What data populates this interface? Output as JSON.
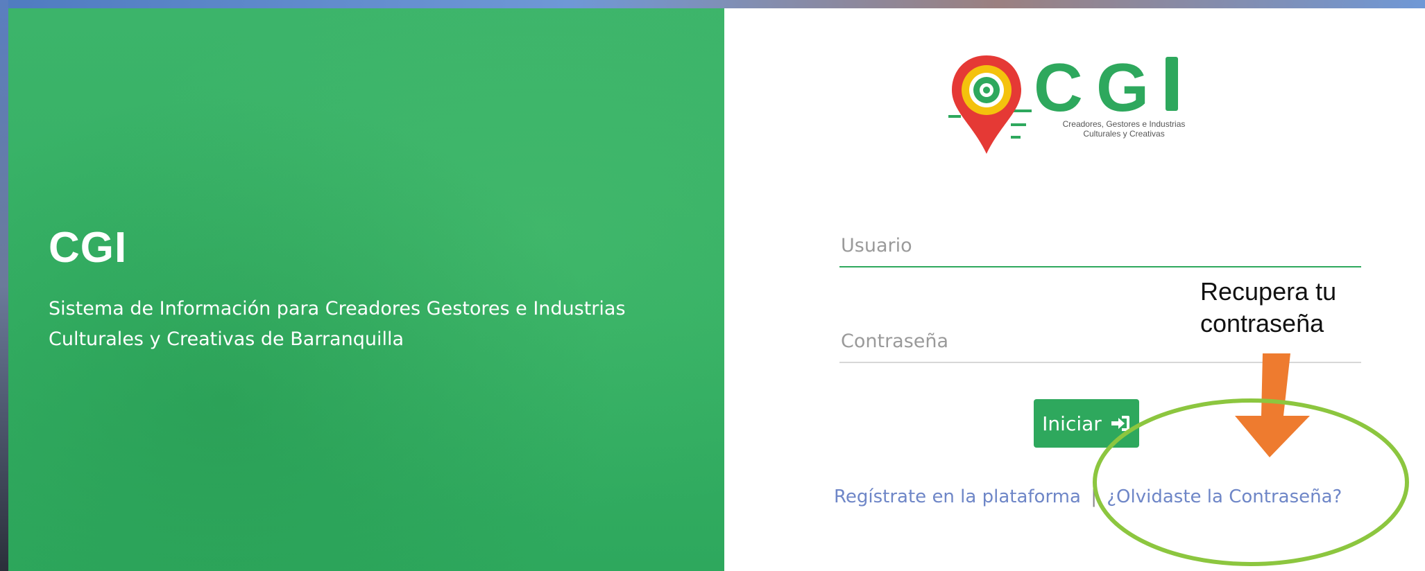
{
  "left_panel": {
    "title": "CGI",
    "description": "Sistema de Información para Creadores Gestores e Industrias Culturales y Creativas de Barranquilla"
  },
  "logo": {
    "letters": "C G I",
    "subtitle_line1": "Creadores, Gestores e Industrias",
    "subtitle_line2": "Culturales y Creativas",
    "colors": {
      "pin_red": "#e53935",
      "ring_yellow": "#f4c20d",
      "letters_green": "#2ea85d"
    }
  },
  "form": {
    "username_placeholder": "Usuario",
    "password_placeholder": "Contraseña",
    "login_button_label": "Iniciar",
    "login_icon": "sign-in-icon"
  },
  "links": {
    "register_label": "Regístrate en la plataforma",
    "separator": "|",
    "forgot_password_label": "¿Olvidaste la Contraseña?"
  },
  "annotation": {
    "text_line1": "Recupera tu",
    "text_line2": "contraseña",
    "arrow_color": "#ee7b2f",
    "ellipse_color": "#8cc63f"
  },
  "colors": {
    "primary_green": "#2ea85d",
    "link_blue": "#6e86c7"
  }
}
